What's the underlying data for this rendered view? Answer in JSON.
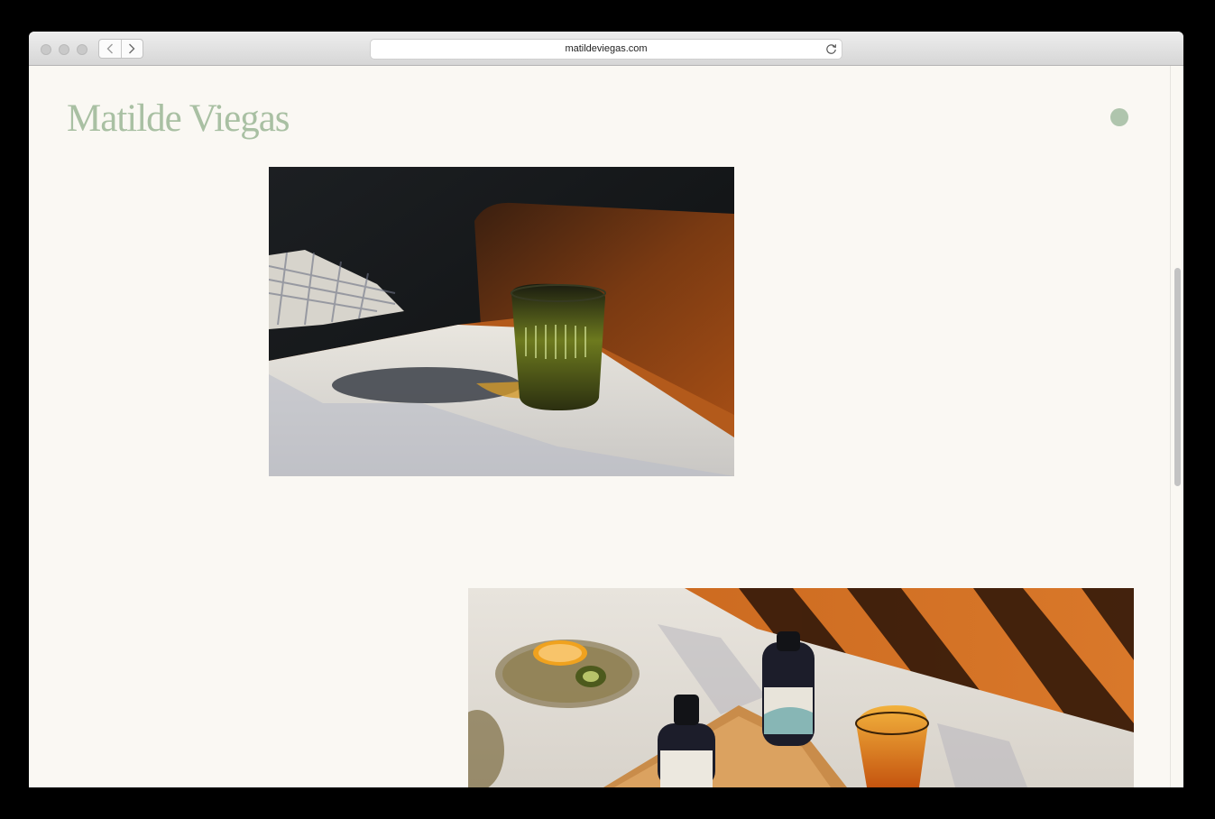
{
  "browser": {
    "url": "matildeviegas.com",
    "traffic_lights": [
      "close",
      "minimize",
      "zoom"
    ],
    "nav_icons": [
      "chevron-left-icon",
      "chevron-right-icon"
    ],
    "reload_icon": "reload-icon"
  },
  "site": {
    "logo": "Matilde Viegas",
    "menu_icon": "menu-dot-icon",
    "accent_color": "#a9c0a3",
    "background_color": "#faf8f3"
  },
  "gallery": {
    "photos": [
      {
        "subject": "glass of green drink on white tablecloth with shadow"
      },
      {
        "subject": "kombucha bottles, orange and kiwi on wooden table"
      }
    ]
  }
}
